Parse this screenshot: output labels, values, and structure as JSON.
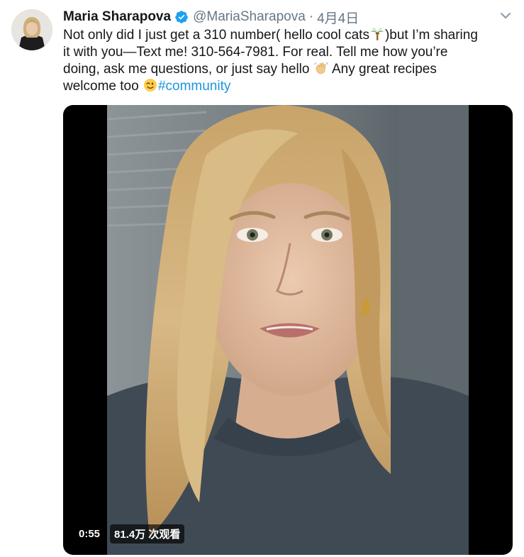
{
  "author": {
    "display_name": "Maria Sharapova",
    "handle": "@MariaSharapova",
    "separator": "·",
    "date": "4月4日",
    "verified": true
  },
  "tweet": {
    "text_line_1": "Not only did I just get a 310 number( hello cool cats",
    "text_line_1b": ")but I’m sharing",
    "text_line_2": "it with you—Text me! 310-564-7981. For real. Tell me how you’re",
    "text_line_3": "doing, ask me questions, or just say hello",
    "text_line_3b": " Any great recipes",
    "text_line_4": "welcome too",
    "hashtag": "#community"
  },
  "emojis": {
    "palm": "palm-tree-emoji",
    "wave": "waving-hand-emoji",
    "wink": "winking-face-emoji"
  },
  "video": {
    "duration": "0:55",
    "views": "81.4万 次观看"
  },
  "colors": {
    "link": "#1b95e0",
    "verified": "#1da1f2",
    "secondary_text": "#657786"
  }
}
